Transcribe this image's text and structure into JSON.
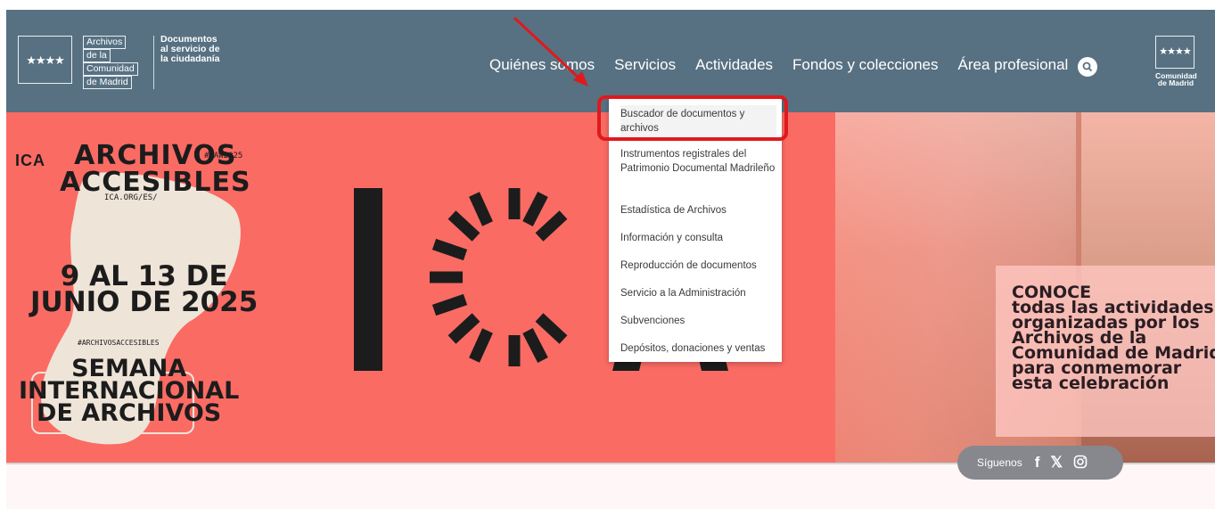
{
  "header": {
    "flag_stars": "★★★★",
    "archive_logo": [
      "Archivos",
      "de la",
      "Comunidad",
      "de Madrid"
    ],
    "tagline": [
      "Documentos",
      "al servicio de",
      "la ciudadanía"
    ],
    "nav": [
      "Quiénes somos",
      "Servicios",
      "Actividades",
      "Fondos y colecciones",
      "Área profesional"
    ],
    "search_icon": "search-icon",
    "cm_flag_stars": "★★★★",
    "cm_name": [
      "Comunidad",
      "de Madrid"
    ]
  },
  "dropdown": {
    "items": [
      "Buscador de documentos y archivos",
      "Instrumentos registrales del Patrimonio Documental Madrileño",
      "Estadística de Archivos",
      "Información y consulta",
      "Reproducción de documentos",
      "Servicio a la Administración",
      "Subvenciones",
      "Depósitos, donaciones y ventas"
    ]
  },
  "hero": {
    "ica_mark": "ICA",
    "title": [
      "ARCHIVOS",
      "ACCESIBLES"
    ],
    "hashtag_top": "#IAW2025",
    "url": "ICA.ORG/ES/",
    "dates": [
      "9 AL 13 DE",
      "JUNIO DE 2025"
    ],
    "hashtag_bottom": "#ARCHIVOSACCESIBLES",
    "week": [
      "SEMANA",
      "INTERNACIONAL",
      "DE ARCHIVOS"
    ],
    "promo": [
      "CONOCE",
      "todas las actividades",
      "organizadas por los",
      "Archivos de la",
      "Comunidad de Madrid",
      "para conmemorar",
      "esta celebración"
    ]
  },
  "social": {
    "label": "Síguenos",
    "icons": [
      "facebook-icon",
      "x-icon",
      "instagram-icon"
    ]
  },
  "colors": {
    "header_bg": "#577182",
    "hero_bg": "#fa6b64",
    "highlight": "#e0191d"
  }
}
